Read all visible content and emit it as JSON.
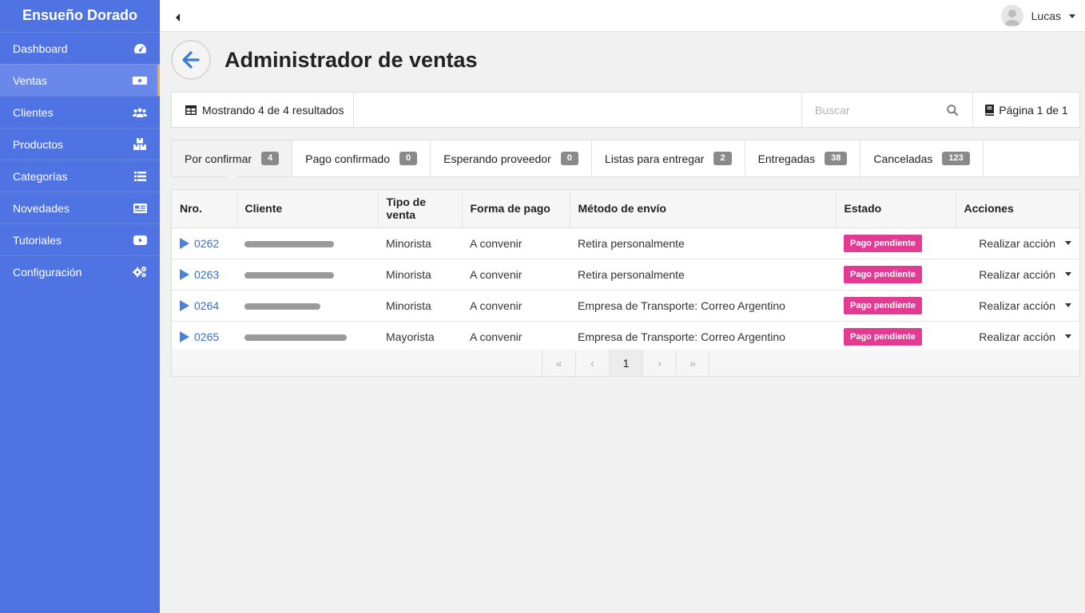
{
  "app": {
    "brand": "Ensueño Dorado"
  },
  "sidebar": {
    "items": [
      {
        "label": "Dashboard",
        "icon": "dashboard-gauge-icon"
      },
      {
        "label": "Ventas",
        "icon": "money-bill-icon",
        "active": true
      },
      {
        "label": "Clientes",
        "icon": "users-icon"
      },
      {
        "label": "Productos",
        "icon": "boxes-icon"
      },
      {
        "label": "Categorías",
        "icon": "list-icon"
      },
      {
        "label": "Novedades",
        "icon": "newspaper-icon"
      },
      {
        "label": "Tutoriales",
        "icon": "youtube-play-icon"
      },
      {
        "label": "Configuración",
        "icon": "cogs-icon"
      }
    ]
  },
  "topbar": {
    "user_name": "Lucas"
  },
  "header": {
    "title": "Administrador de ventas"
  },
  "toolbar": {
    "results_text": "Mostrando 4 de 4 resultados",
    "search_placeholder": "Buscar",
    "search_value": "",
    "page_info": "Página 1 de 1"
  },
  "tabs": [
    {
      "label": "Por confirmar",
      "count": "4",
      "active": true
    },
    {
      "label": "Pago confirmado",
      "count": "0"
    },
    {
      "label": "Esperando proveedor",
      "count": "0"
    },
    {
      "label": "Listas para entregar",
      "count": "2"
    },
    {
      "label": "Entregadas",
      "count": "38"
    },
    {
      "label": "Canceladas",
      "count": "123"
    }
  ],
  "table": {
    "columns": [
      "Nro.",
      "Cliente",
      "Tipo de venta",
      "Forma de pago",
      "Método de envío",
      "Estado",
      "Acciones"
    ],
    "rows": [
      {
        "nro": "0262",
        "cliente": "",
        "tipo": "Minorista",
        "forma": "A convenir",
        "envio": "Retira personalmente",
        "estado": "Pago pendiente",
        "accion": "Realizar acción"
      },
      {
        "nro": "0263",
        "cliente": "",
        "tipo": "Minorista",
        "forma": "A convenir",
        "envio": "Retira personalmente",
        "estado": "Pago pendiente",
        "accion": "Realizar acción"
      },
      {
        "nro": "0264",
        "cliente": "",
        "tipo": "Minorista",
        "forma": "A convenir",
        "envio": "Empresa de Transporte: Correo Argentino",
        "estado": "Pago pendiente",
        "accion": "Realizar acción"
      },
      {
        "nro": "0265",
        "cliente": "",
        "tipo": "Mayorista",
        "forma": "A convenir",
        "envio": "Empresa de Transporte: Correo Argentino",
        "estado": "Pago pendiente",
        "accion": "Realizar acción"
      }
    ]
  },
  "pagination": {
    "first": "«",
    "prev": "‹",
    "current": "1",
    "next": "›",
    "last": "»"
  },
  "colors": {
    "sidebar": "#4f73e3",
    "sidebar_active": "#6a88ea",
    "accent": "#f4a93b",
    "status_pending": "#e33a93",
    "link": "#3a6fc4"
  }
}
